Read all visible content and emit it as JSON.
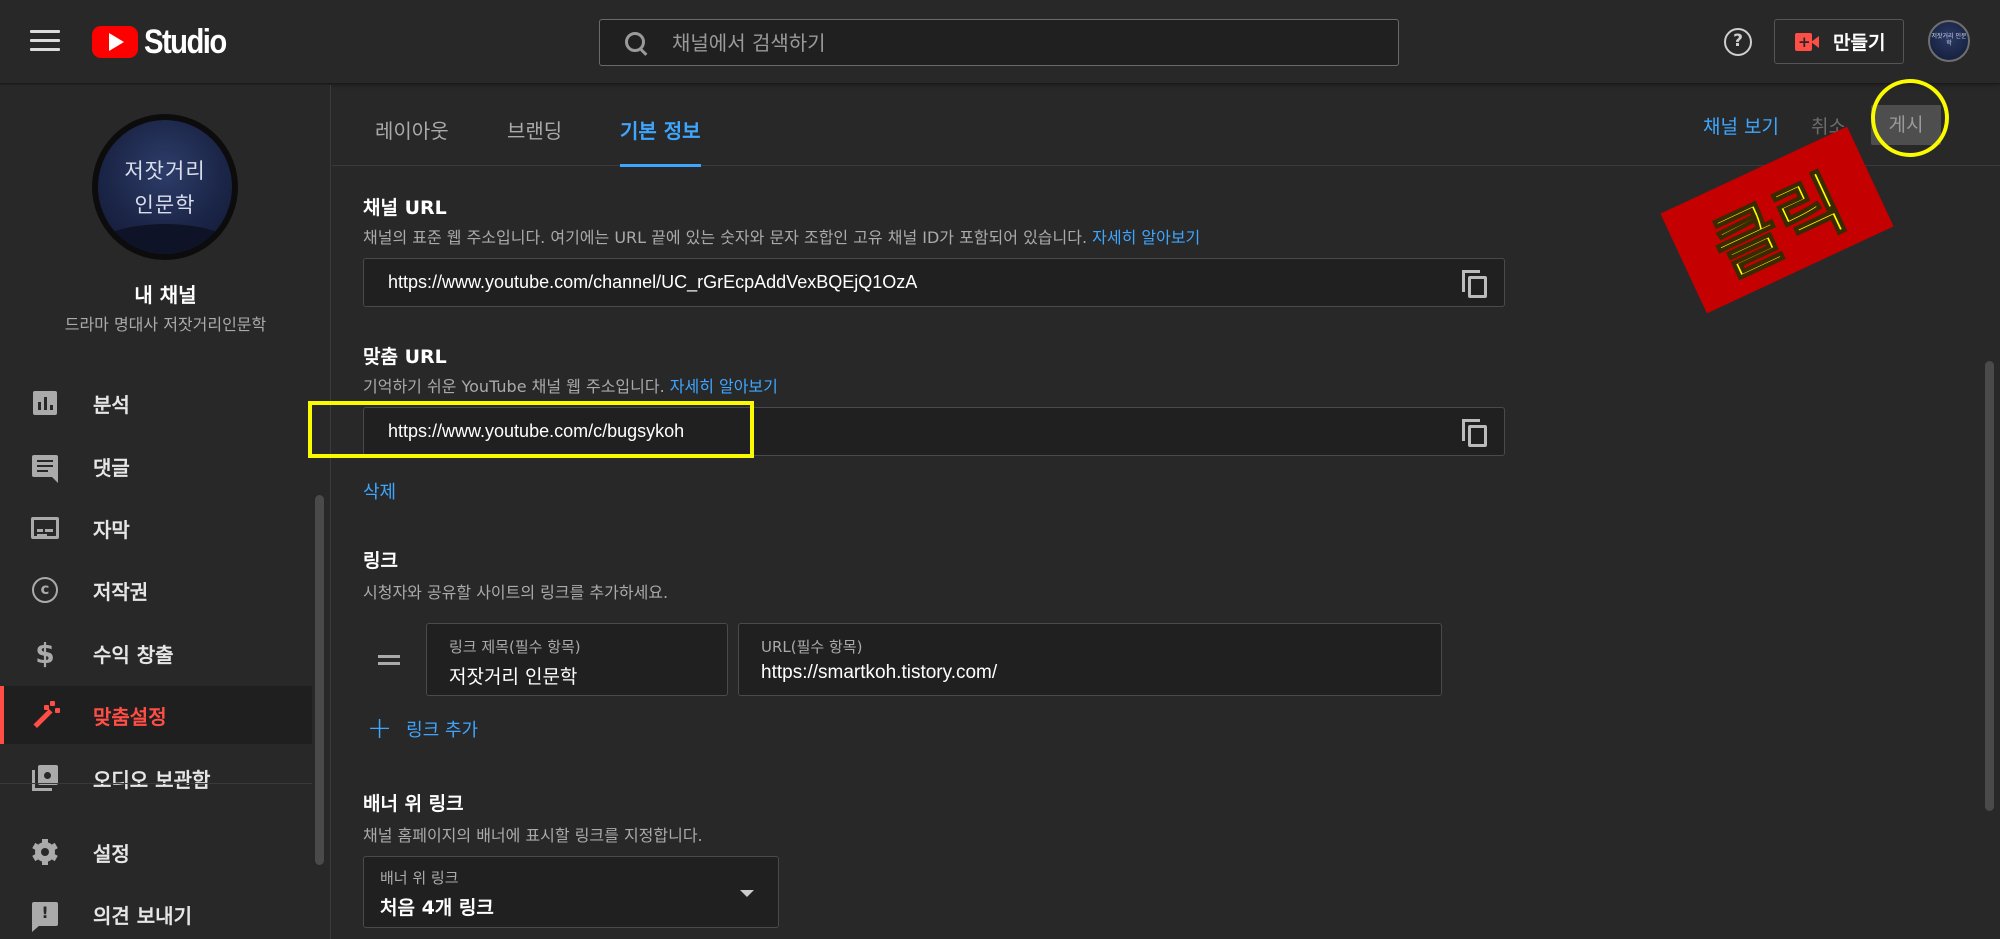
{
  "header": {
    "logo_text": "Studio",
    "search_placeholder": "채널에서 검색하기",
    "help_symbol": "?",
    "create_label": "만들기",
    "avatar_text": "저잣거리 인문학"
  },
  "sidebar": {
    "avatar_line1": "저잣거리",
    "avatar_line2": "인문학",
    "channel_name": "내 채널",
    "channel_subtitle": "드라마 명대사 저잣거리인문학",
    "items": [
      {
        "label": "분석",
        "icon": "analytics-icon"
      },
      {
        "label": "댓글",
        "icon": "comment-icon"
      },
      {
        "label": "자막",
        "icon": "subtitles-icon"
      },
      {
        "label": "저작권",
        "icon": "copyright-icon"
      },
      {
        "label": "수익 창출",
        "icon": "dollar-icon"
      },
      {
        "label": "맞춤설정",
        "icon": "magic-wand-icon",
        "active": true
      },
      {
        "label": "오디오 보관함",
        "icon": "audio-library-icon"
      },
      {
        "label": "설정",
        "icon": "gear-icon"
      },
      {
        "label": "의견 보내기",
        "icon": "feedback-icon"
      }
    ]
  },
  "tabs": [
    {
      "label": "레이아웃"
    },
    {
      "label": "브랜딩"
    },
    {
      "label": "기본 정보",
      "active": true
    }
  ],
  "actions": {
    "view_channel": "채널 보기",
    "cancel": "취소",
    "publish": "게시",
    "annotation": "클릭"
  },
  "sections": {
    "channel_url": {
      "title_prefix": "채널",
      "title_suffix": " URL",
      "desc": "채널의 표준 웹 주소입니다. 여기에는 URL 끝에 있는 숫자와 문자 조합인 고유 채널 ID가 포함되어 있습니다. ",
      "learn_more": "자세히 알아보기",
      "value": "https://www.youtube.com/channel/UC_rGrEcpAddVexBQEjQ1OzA"
    },
    "custom_url": {
      "title_prefix": "맞춤",
      "title_suffix": " URL",
      "desc": "기억하기 쉬운 YouTube 채널 웹 주소입니다. ",
      "learn_more": "자세히 알아보기",
      "value": "https://www.youtube.com/c/bugsykoh",
      "delete": "삭제"
    },
    "links": {
      "title": "링크",
      "desc": "시청자와 공유할 사이트의 링크를 추가하세요.",
      "title_field_label": "링크 제목(필수 항목)",
      "title_field_value": "저잣거리 인문학",
      "url_field_label": "URL(필수 항목)",
      "url_field_value": "https://smartkoh.tistory.com/",
      "add_link": "링크 추가"
    },
    "banner_links": {
      "title": "배너 위 링크",
      "desc": "채널 홈페이지의 배너에 표시할 링크를 지정합니다.",
      "select_label": "배너 위 링크",
      "select_value": "처음 4개 링크"
    }
  },
  "colors": {
    "background": "#282828",
    "accent_blue": "#3ea6ff",
    "active_red": "#ff4e45",
    "highlight_yellow": "#fafa00",
    "stamp_red": "#c40000"
  }
}
